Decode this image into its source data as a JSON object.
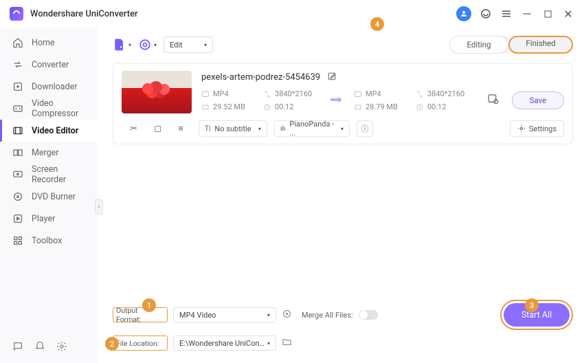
{
  "app": {
    "title": "Wondershare UniConverter"
  },
  "sidebar": {
    "items": [
      {
        "label": "Home"
      },
      {
        "label": "Converter"
      },
      {
        "label": "Downloader"
      },
      {
        "label": "Video Compressor"
      },
      {
        "label": "Video Editor"
      },
      {
        "label": "Merger"
      },
      {
        "label": "Screen Recorder"
      },
      {
        "label": "DVD Burner"
      },
      {
        "label": "Player"
      },
      {
        "label": "Toolbox"
      }
    ]
  },
  "toolbar": {
    "edit_label": "Edit",
    "tabs": {
      "editing": "Editing",
      "finished": "Finished"
    }
  },
  "file": {
    "name": "pexels-artem-podrez-5454639",
    "src": {
      "format": "MP4",
      "resolution": "3840*2160",
      "size": "29.52 MB",
      "duration": "00:12"
    },
    "dst": {
      "format": "MP4",
      "resolution": "3840*2160",
      "size": "28.79 MB",
      "duration": "00:12"
    },
    "subtitle": "No subtitle",
    "audio": "PianoPanda - ...",
    "settings_label": "Settings",
    "save_label": "Save"
  },
  "output": {
    "format_label": "Output Format:",
    "format_value": "MP4 Video",
    "location_label": "File Location:",
    "location_value": "E:\\Wondershare UniConverter",
    "merge_label": "Merge All Files:"
  },
  "actions": {
    "start_all": "Start All"
  },
  "callouts": {
    "c1": "1",
    "c2": "2",
    "c3": "3",
    "c4": "4"
  }
}
